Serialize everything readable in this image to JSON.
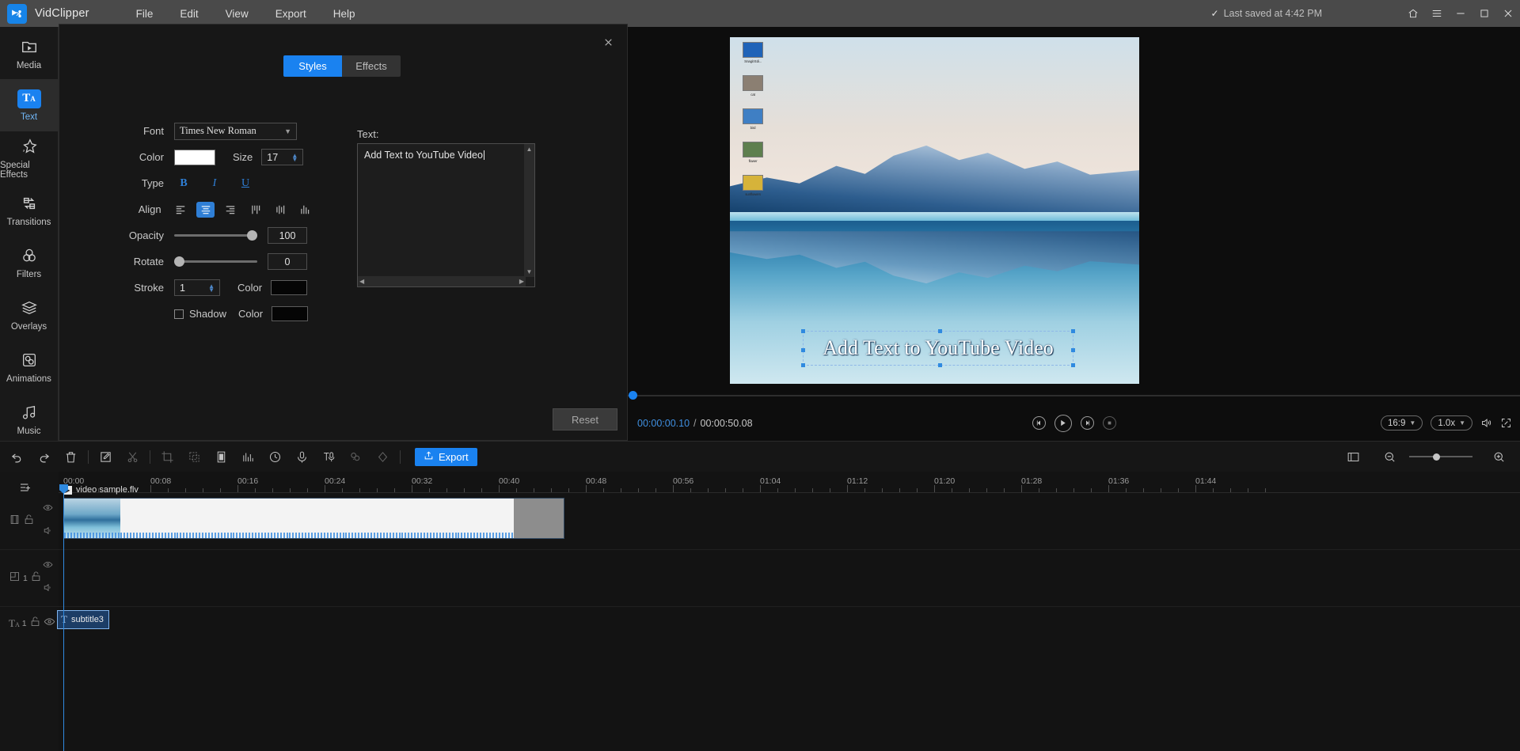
{
  "titlebar": {
    "app_name": "VidClipper",
    "menus": [
      "File",
      "Edit",
      "View",
      "Export",
      "Help"
    ],
    "saved_status": "Last saved at 4:42 PM",
    "check_icon": "check-icon",
    "window_buttons": [
      "home-icon",
      "hamburger-menu-icon",
      "minimize-icon",
      "maximize-icon",
      "close-icon"
    ]
  },
  "sidebar": {
    "items": [
      {
        "label": "Media",
        "icon": "media-folder-icon",
        "active": false
      },
      {
        "label": "Text",
        "icon": "text-icon",
        "active": true
      },
      {
        "label": "Special Effects",
        "icon": "star-sparkle-icon",
        "active": false
      },
      {
        "label": "Transitions",
        "icon": "transitions-icon",
        "active": false
      },
      {
        "label": "Filters",
        "icon": "filters-circles-icon",
        "active": false
      },
      {
        "label": "Overlays",
        "icon": "layers-icon",
        "active": false
      },
      {
        "label": "Animations",
        "icon": "animations-icon",
        "active": false
      },
      {
        "label": "Music",
        "icon": "music-note-icon",
        "active": false
      }
    ]
  },
  "panel": {
    "tabs": [
      {
        "label": "Styles",
        "active": true
      },
      {
        "label": "Effects",
        "active": false
      }
    ],
    "close_icon": "close-icon",
    "font": {
      "label": "Font",
      "value": "Times New Roman"
    },
    "color": {
      "label": "Color",
      "value": "#ffffff"
    },
    "size": {
      "label": "Size",
      "value": "17"
    },
    "type": {
      "label": "Type",
      "bold": "B",
      "italic": "I",
      "underline": "U"
    },
    "align": {
      "label": "Align",
      "options": [
        "align-left-icon",
        "align-center-icon",
        "align-right-icon",
        "valign-top-icon",
        "valign-middle-icon",
        "valign-bottom-icon"
      ],
      "active_index": 1
    },
    "opacity": {
      "label": "Opacity",
      "value": "100",
      "percent": 100
    },
    "rotate": {
      "label": "Rotate",
      "value": "0",
      "percent": 0
    },
    "stroke": {
      "label": "Stroke",
      "value": "1",
      "color_label": "Color",
      "color": "#050505"
    },
    "shadow": {
      "label": "Shadow",
      "checked": false,
      "color_label": "Color",
      "color": "#050505"
    },
    "text": {
      "label": "Text:",
      "value": "Add Text to YouTube Video"
    },
    "reset_label": "Reset"
  },
  "preview": {
    "caption": "Add Text to YouTube Video",
    "desktop_icons": [
      {
        "label": "Snagit Edi..."
      },
      {
        "label": "cat"
      },
      {
        "label": "bird"
      },
      {
        "label": "flower"
      },
      {
        "label": "sunflowers"
      }
    ],
    "time_current": "00:00:00.10",
    "time_separator": "/",
    "time_total": "00:00:50.08",
    "playback": [
      "prev-frame-icon",
      "play-icon",
      "next-frame-icon",
      "stop-icon"
    ],
    "aspect_ratio": "16:9",
    "speed": "1.0x",
    "volume_icon": "volume-icon",
    "fullscreen_icon": "fullscreen-icon"
  },
  "toolbar": {
    "tools": [
      "undo-icon",
      "redo-icon",
      "delete-icon",
      "edit-icon",
      "split-scissors-icon",
      "crop-icon",
      "duplicate-icon",
      "mosaic-icon",
      "audio-detach-icon",
      "clock-icon",
      "microphone-icon",
      "text-to-speech-icon",
      "speech-to-text-icon",
      "keyframe-icon"
    ],
    "export_label": "Export",
    "export_icon": "export-icon",
    "right_tools": [
      "fit-timeline-icon",
      "zoom-out-icon",
      "zoom-in-icon"
    ]
  },
  "timeline": {
    "add_track_icon": "add-track-icon",
    "ruler_labels": [
      "00:00",
      "00:08",
      "00:16",
      "00:24",
      "00:32",
      "00:40",
      "00:48",
      "00:56",
      "01:04",
      "01:12",
      "01:20",
      "01:28",
      "01:36",
      "01:44"
    ],
    "tracks": [
      {
        "type": "video",
        "icon": "film-icon",
        "lock_icon": "unlock-icon",
        "eye_icon": "eye-icon",
        "audio_icon": "speaker-icon",
        "clip_name": "video sample.flv",
        "number": ""
      },
      {
        "type": "overlay",
        "icon": "overlay-icon",
        "lock_icon": "unlock-icon",
        "eye_icon": "eye-icon",
        "audio_icon": "speaker-icon",
        "clip_name": "",
        "number": "1"
      },
      {
        "type": "text",
        "icon": "text-track-icon",
        "lock_icon": "unlock-icon",
        "eye_icon": "eye-icon",
        "audio_icon": "",
        "clip_name": "subtitle3",
        "number": "1"
      }
    ]
  },
  "colors": {
    "accent": "#1a82f0",
    "titlebar_bg": "#4a4a4a",
    "panel_bg": "#171717",
    "timeline_bg": "#131313"
  }
}
